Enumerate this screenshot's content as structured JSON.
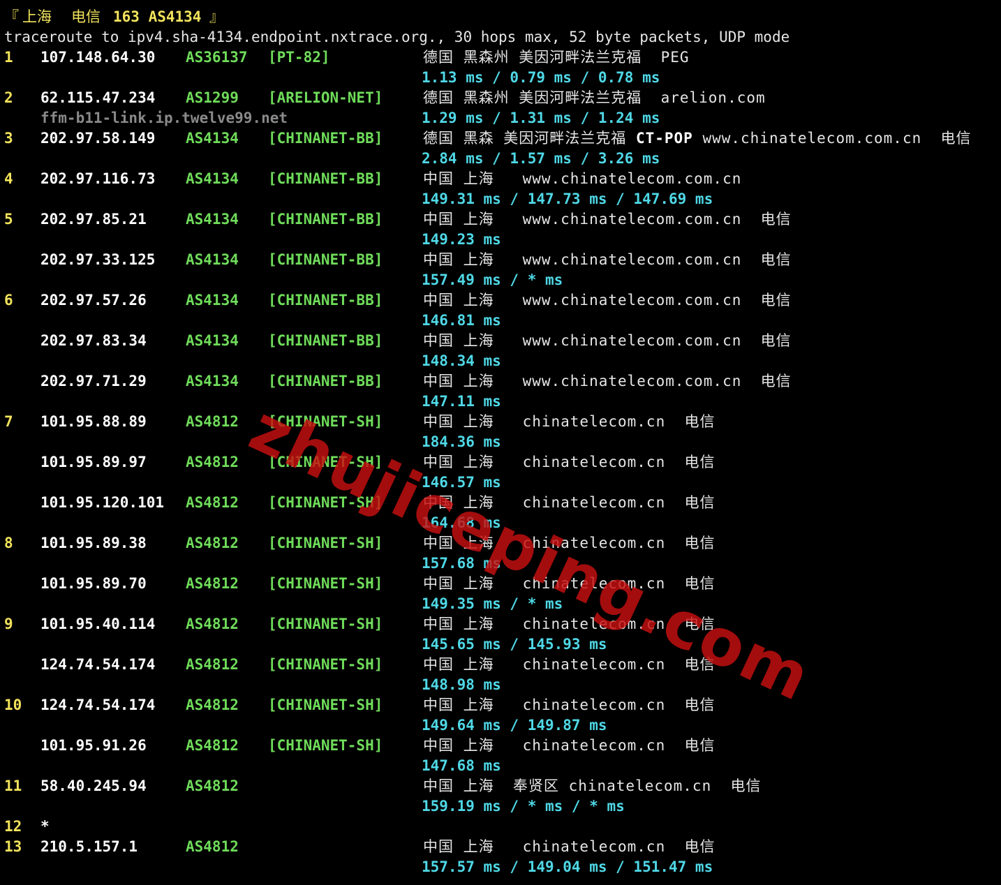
{
  "header": {
    "bracket_open": "『",
    "city": "上海",
    "isp": "电信",
    "asn": "163 AS4134",
    "bracket_close": "』",
    "command": "traceroute to ipv4.sha-4134.endpoint.nxtrace.org., 30 hops max, 52 byte packets, UDP mode"
  },
  "hops": [
    {
      "hop": "1",
      "ip": "107.148.64.30",
      "asn": "AS36137",
      "tag": "[PT-82]",
      "geo": "德国 黑森州 美因河畔法兰克福  PEG",
      "rtt": "1.13 ms / 0.79 ms / 0.78 ms"
    },
    {
      "hop": "2",
      "ip": "62.115.47.234",
      "asn": "AS1299",
      "tag": "[ARELION-NET]",
      "geo": "德国 黑森州 美因河畔法兰克福  arelion.com",
      "rtt": "1.29 ms / 1.31 ms / 1.24 ms",
      "ptr": "ffm-b11-link.ip.twelve99.net"
    },
    {
      "hop": "3",
      "ip": "202.97.58.149",
      "asn": "AS4134",
      "tag": "[CHINANET-BB]",
      "geo_pre": "德国 黑森 美因河畔法兰克福 ",
      "geo_bold": "CT-POP",
      "geo_post": " www.chinatelecom.com.cn  电信",
      "rtt": "2.84 ms / 1.57 ms / 3.26 ms"
    },
    {
      "hop": "4",
      "ip": "202.97.116.73",
      "asn": "AS4134",
      "tag": "[CHINANET-BB]",
      "geo": "中国 上海   www.chinatelecom.com.cn",
      "rtt": "149.31 ms / 147.73 ms / 147.69 ms"
    },
    {
      "hop": "5",
      "ip": "202.97.85.21",
      "asn": "AS4134",
      "tag": "[CHINANET-BB]",
      "geo": "中国 上海   www.chinatelecom.com.cn  电信",
      "rtt": "149.23 ms"
    },
    {
      "hop": "",
      "ip": "202.97.33.125",
      "asn": "AS4134",
      "tag": "[CHINANET-BB]",
      "geo": "中国 上海   www.chinatelecom.com.cn  电信",
      "rtt": "157.49 ms / * ms"
    },
    {
      "hop": "6",
      "ip": "202.97.57.26",
      "asn": "AS4134",
      "tag": "[CHINANET-BB]",
      "geo": "中国 上海   www.chinatelecom.com.cn  电信",
      "rtt": "146.81 ms"
    },
    {
      "hop": "",
      "ip": "202.97.83.34",
      "asn": "AS4134",
      "tag": "[CHINANET-BB]",
      "geo": "中国 上海   www.chinatelecom.com.cn  电信",
      "rtt": "148.34 ms"
    },
    {
      "hop": "",
      "ip": "202.97.71.29",
      "asn": "AS4134",
      "tag": "[CHINANET-BB]",
      "geo": "中国 上海   www.chinatelecom.com.cn  电信",
      "rtt": "147.11 ms"
    },
    {
      "hop": "7",
      "ip": "101.95.88.89",
      "asn": "AS4812",
      "tag": "[CHINANET-SH]",
      "geo": "中国 上海   chinatelecom.cn  电信",
      "rtt": "184.36 ms"
    },
    {
      "hop": "",
      "ip": "101.95.89.97",
      "asn": "AS4812",
      "tag": "[CHINANET-SH]",
      "geo": "中国 上海   chinatelecom.cn  电信",
      "rtt": "146.57 ms"
    },
    {
      "hop": "",
      "ip": "101.95.120.101",
      "asn": "AS4812",
      "tag": "[CHINANET-SH]",
      "geo": "中国 上海   chinatelecom.cn  电信",
      "rtt": "164.68 ms"
    },
    {
      "hop": "8",
      "ip": "101.95.89.38",
      "asn": "AS4812",
      "tag": "[CHINANET-SH]",
      "geo": "中国 上海   chinatelecom.cn  电信",
      "rtt": "157.68 ms"
    },
    {
      "hop": "",
      "ip": "101.95.89.70",
      "asn": "AS4812",
      "tag": "[CHINANET-SH]",
      "geo": "中国 上海   chinatelecom.cn  电信",
      "rtt": "149.35 ms / * ms"
    },
    {
      "hop": "9",
      "ip": "101.95.40.114",
      "asn": "AS4812",
      "tag": "[CHINANET-SH]",
      "geo": "中国 上海   chinatelecom.cn  电信",
      "rtt": "145.65 ms / 145.93 ms"
    },
    {
      "hop": "",
      "ip": "124.74.54.174",
      "asn": "AS4812",
      "tag": "[CHINANET-SH]",
      "geo": "中国 上海   chinatelecom.cn  电信",
      "rtt": "148.98 ms"
    },
    {
      "hop": "10",
      "ip": "124.74.54.174",
      "asn": "AS4812",
      "tag": "[CHINANET-SH]",
      "geo": "中国 上海   chinatelecom.cn  电信",
      "rtt": "149.64 ms / 149.87 ms"
    },
    {
      "hop": "",
      "ip": "101.95.91.26",
      "asn": "AS4812",
      "tag": "[CHINANET-SH]",
      "geo": "中国 上海   chinatelecom.cn  电信",
      "rtt": "147.68 ms"
    },
    {
      "hop": "11",
      "ip": "58.40.245.94",
      "asn": "AS4812",
      "tag": "",
      "geo": "中国 上海  奉贤区 chinatelecom.cn  电信",
      "rtt": "159.19 ms / * ms / * ms"
    },
    {
      "hop": "12",
      "ip": "*",
      "asn": "",
      "tag": "",
      "geo": "",
      "rtt": ""
    },
    {
      "hop": "13",
      "ip": "210.5.157.1",
      "asn": "AS4812",
      "tag": "",
      "geo": "中国 上海   chinatelecom.cn  电信",
      "rtt": "157.57 ms / 149.04 ms / 151.47 ms"
    }
  ],
  "watermark": "zhujiceping.com",
  "colors": {
    "background": "#000000",
    "hop_number": "#f2e35c",
    "asn_tag": "#6fdc5a",
    "rtt": "#4fd8e6",
    "ptr": "#8a8a8a",
    "watermark": "#c81010"
  }
}
